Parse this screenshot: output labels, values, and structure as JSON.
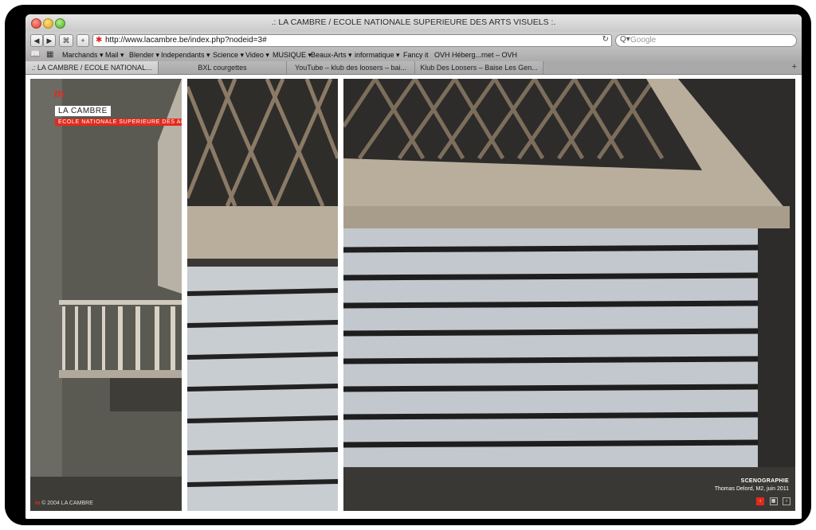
{
  "window": {
    "title": ".: LA CAMBRE / ECOLE NATIONALE SUPERIEURE DES ARTS VISUELS :."
  },
  "toolbar": {
    "back_icon": "back-arrow-icon",
    "forward_icon": "forward-arrow-icon",
    "url": "http://www.lacambre.be/index.php?nodeid=3#",
    "search_placeholder": "Google",
    "add_label": "+"
  },
  "bookmarks": [
    "Marchands ▾",
    "Mail ▾",
    "Blender ▾",
    "Independants ▾",
    "Science ▾",
    "Video ▾",
    "MUSIQUE ▾",
    "Beaux-Arts ▾",
    "informatique ▾",
    "Fancy it",
    "OVH Héberg...rnet – OVH"
  ],
  "tabs": [
    {
      "label": ".: LA CAMBRE / ECOLE NATIONAL..."
    },
    {
      "label": "BXL courgettes"
    },
    {
      "label": "YouTube – klub des loosers – bai..."
    },
    {
      "label": "Klub Des Loosers – Baise Les Gen..."
    }
  ],
  "site": {
    "logo": "m",
    "name": "LA CAMBRE",
    "subtitle": "ECOLE NATIONALE SUPERIEURE DES ARTS VISUELS",
    "copyright": "© 2004 LA CAMBRE",
    "caption_title": "SCENOGRAPHIE",
    "caption_author": "Thomas Delord, M2, juin 2011"
  }
}
